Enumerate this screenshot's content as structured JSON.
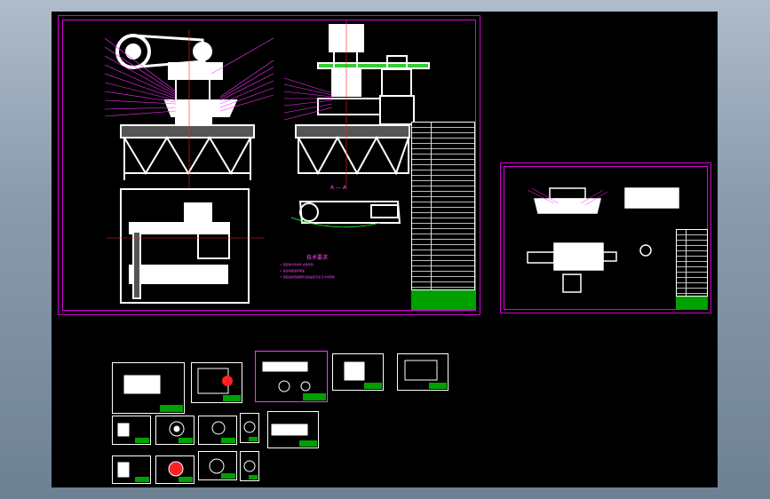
{
  "drawing": {
    "notes_title": "技术要求",
    "notes_lines": [
      "1. 装配前清洗零件,去除毛刺",
      "2. 各运动副加润滑油",
      "3. 装配后检查各部件运动是否灵活,无卡滞现象"
    ],
    "section_label": "A — A"
  },
  "colors": {
    "background": "#000000",
    "frame": "#d400d4",
    "geometry": "#ffffff",
    "title_block": "#00a000",
    "leader": "#ff33ff",
    "centerline": "#ff2020"
  }
}
